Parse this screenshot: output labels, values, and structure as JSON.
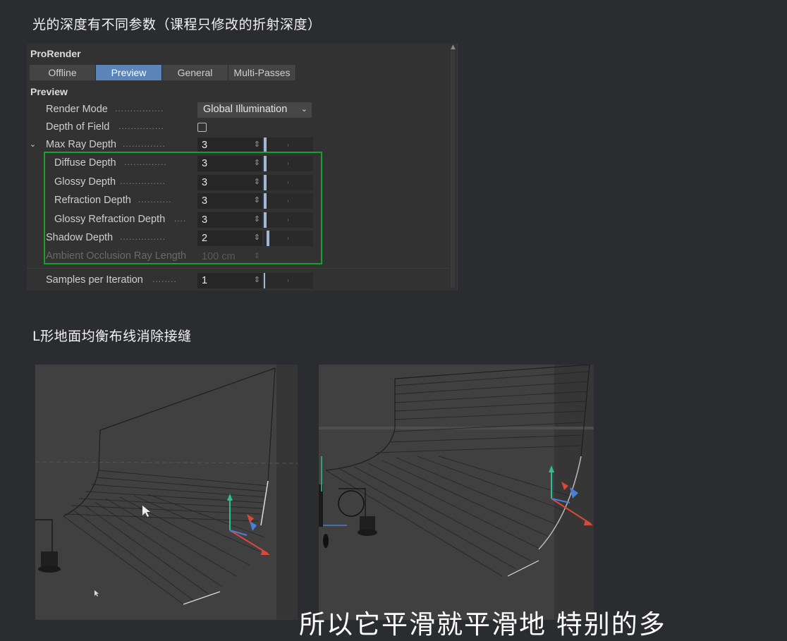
{
  "headings": {
    "top": "光的深度有不同参数（课程只修改的折射深度）",
    "bottom": "L形地面均衡布线消除接缝"
  },
  "panel": {
    "title": "ProRender",
    "tabs": [
      "Offline",
      "Preview",
      "General",
      "Multi-Passes"
    ],
    "active_tab": "Preview",
    "section": "Preview",
    "render_mode": {
      "label": "Render Mode",
      "value": "Global Illumination"
    },
    "depth_of_field": {
      "label": "Depth of Field",
      "checked": false
    },
    "max_ray_depth": {
      "label": "Max Ray Depth",
      "value": "3"
    },
    "diffuse_depth": {
      "label": "Diffuse Depth",
      "value": "3"
    },
    "glossy_depth": {
      "label": "Glossy Depth",
      "value": "3"
    },
    "refraction_depth": {
      "label": "Refraction Depth",
      "value": "3"
    },
    "glossy_refraction_depth": {
      "label": "Glossy Refraction Depth",
      "value": "3"
    },
    "shadow_depth": {
      "label": "Shadow Depth",
      "value": "2"
    },
    "ao_ray_length": {
      "label": "Ambient Occlusion Ray Length",
      "value": "100 cm"
    },
    "samples_per_iteration": {
      "label": "Samples per Iteration",
      "value": "1"
    }
  },
  "colors": {
    "highlight": "#16a02c",
    "active_tab": "#5b85b8",
    "background": "#2b2c2f"
  },
  "viewports": [
    {
      "name": "viewport-left",
      "content": "L-shaped floor wireframe with axis gizmo"
    },
    {
      "name": "viewport-right",
      "content": "L-shaped floor wireframe with lamp model"
    }
  ],
  "subtitle": "所以它平滑就平滑地 特别的多"
}
